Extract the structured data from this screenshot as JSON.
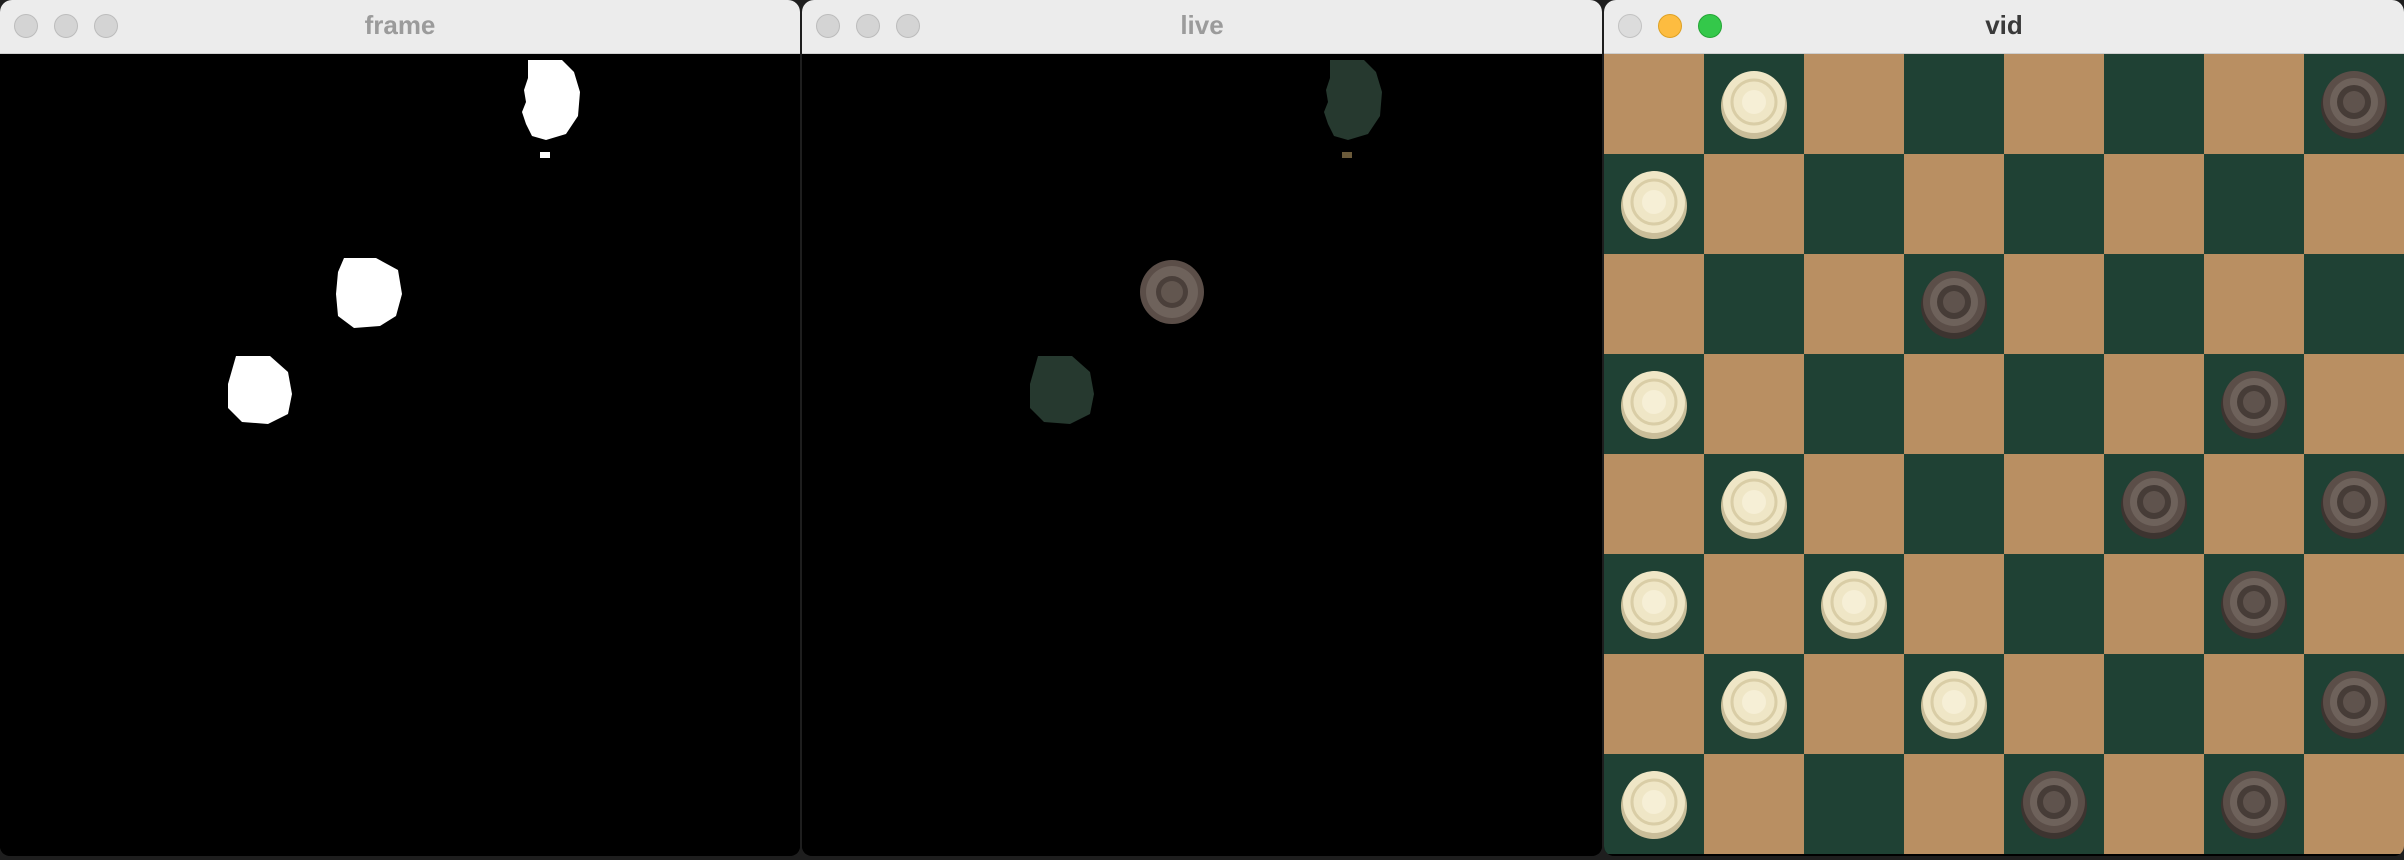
{
  "windows": [
    {
      "title": "frame",
      "active": false
    },
    {
      "title": "live",
      "active": false
    },
    {
      "title": "vid",
      "active": true
    }
  ],
  "icons": {
    "close": "close-icon",
    "minimize": "minimize-icon",
    "zoom": "zoom-icon"
  },
  "colors": {
    "board_light": "#b98f62",
    "board_dark": "#1f4134",
    "piece_light": "#efe6c6",
    "piece_dark": "#5b4e48",
    "mask_white": "#ffffff",
    "live_green_blob": "#26392f"
  }
}
